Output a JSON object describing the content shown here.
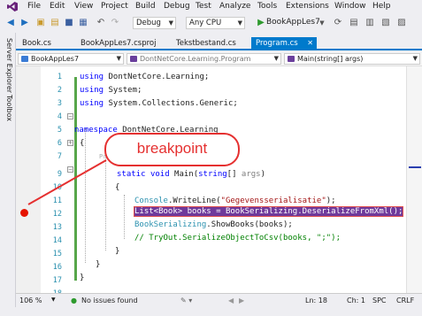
{
  "menubar": {
    "items": [
      "File",
      "Edit",
      "View",
      "Project",
      "Build",
      "Debug",
      "Test",
      "Analyze",
      "Tools",
      "Extensions",
      "Window",
      "Help"
    ]
  },
  "toolbar": {
    "config": "Debug",
    "platform": "Any CPU",
    "run_target": "BookAppLes7"
  },
  "rail": {
    "server_explorer": "Server Explorer",
    "toolbox": "Toolbox"
  },
  "tabs": [
    {
      "label": "Book.cs",
      "active": false
    },
    {
      "label": "BookAppLes7.csproj",
      "active": false
    },
    {
      "label": "Tekstbestand.cs",
      "active": false
    },
    {
      "label": "Program.cs",
      "active": true
    }
  ],
  "navbar": {
    "project": "BookAppLes7",
    "type": "DontNetCore.Learning.Program",
    "member": "Main(string[] args)"
  },
  "editor": {
    "line_numbers": [
      "1",
      "2",
      "3",
      "4",
      "5",
      "6",
      "7",
      "8",
      "9",
      "10",
      "11",
      "12",
      "13",
      "14",
      "15",
      "16",
      "17",
      "18"
    ],
    "breakpoint_line": "12"
  },
  "annotation": {
    "label": "breakpoint",
    "color": "#e53030"
  },
  "status": {
    "zoom": "106 %",
    "issues": "No issues found",
    "line": "Ln: 18",
    "col": "Ch: 1",
    "spacing": "SPC",
    "eol": "CRLF"
  },
  "colors": {
    "accent": "#007acc",
    "breakpoint": "#e51400",
    "highlight": "#6f3a9b"
  }
}
